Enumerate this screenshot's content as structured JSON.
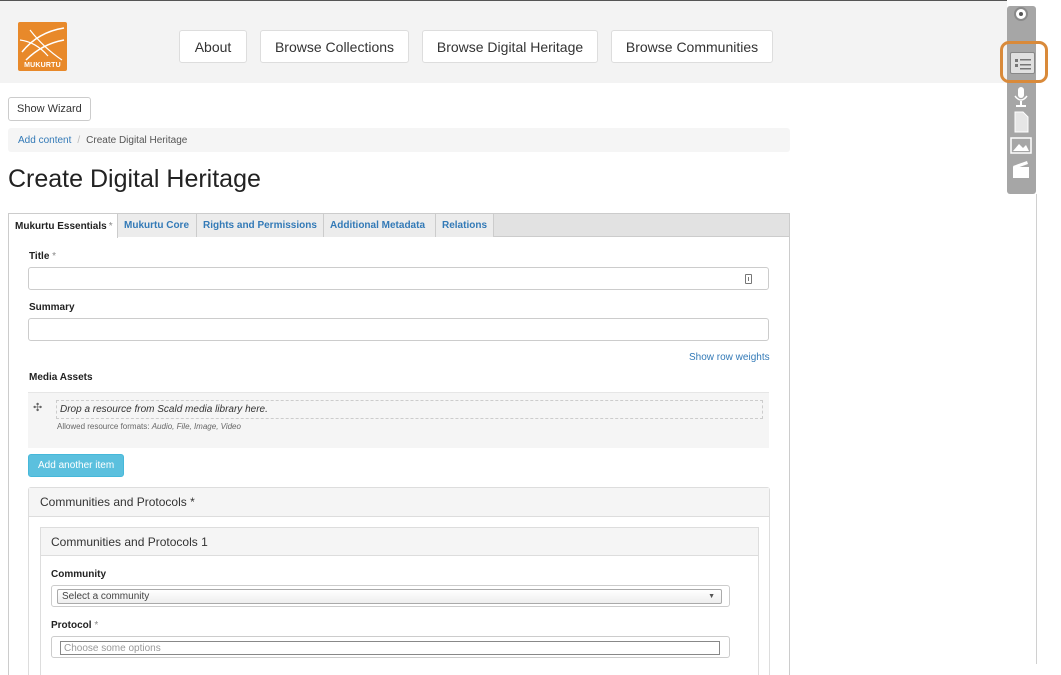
{
  "header": {
    "logo_text": "MUKURTU",
    "nav": [
      "About",
      "Browse Collections",
      "Browse Digital Heritage",
      "Browse Communities"
    ]
  },
  "wizard_button": "Show Wizard",
  "breadcrumb": {
    "link": "Add content",
    "separator": "/",
    "current": "Create Digital Heritage"
  },
  "page_title": "Create Digital Heritage",
  "tabs": [
    {
      "label": "Mukurtu Essentials",
      "required": "*",
      "active": true
    },
    {
      "label": "Mukurtu Core"
    },
    {
      "label": "Rights and Permissions"
    },
    {
      "label": "Additional Metadata"
    },
    {
      "label": "Relations"
    }
  ],
  "form": {
    "title_label": "Title",
    "required_mark": "*",
    "summary_label": "Summary",
    "row_weights": "Show row weights",
    "media_label": "Media Assets",
    "drop_text": "Drop a resource from Scald media library here.",
    "formats_prefix": "Allowed resource formats:",
    "formats_list": "Audio, File, Image, Video",
    "add_item": "Add another item",
    "communities_legend": "Communities and Protocols *",
    "communities_inner": "Communities and Protocols 1",
    "community_label": "Community",
    "community_select": "Select a community",
    "protocol_label": "Protocol",
    "protocol_placeholder": "Choose some options"
  },
  "colors": {
    "accent": "#337ab7",
    "logo": "#e8892a",
    "add_button": "#5bc0de",
    "highlight": "#d98a3a"
  },
  "toolbar_icons": [
    "close-dot-icon",
    "list-icon",
    "microphone-icon",
    "document-icon",
    "image-icon",
    "video-icon"
  ]
}
